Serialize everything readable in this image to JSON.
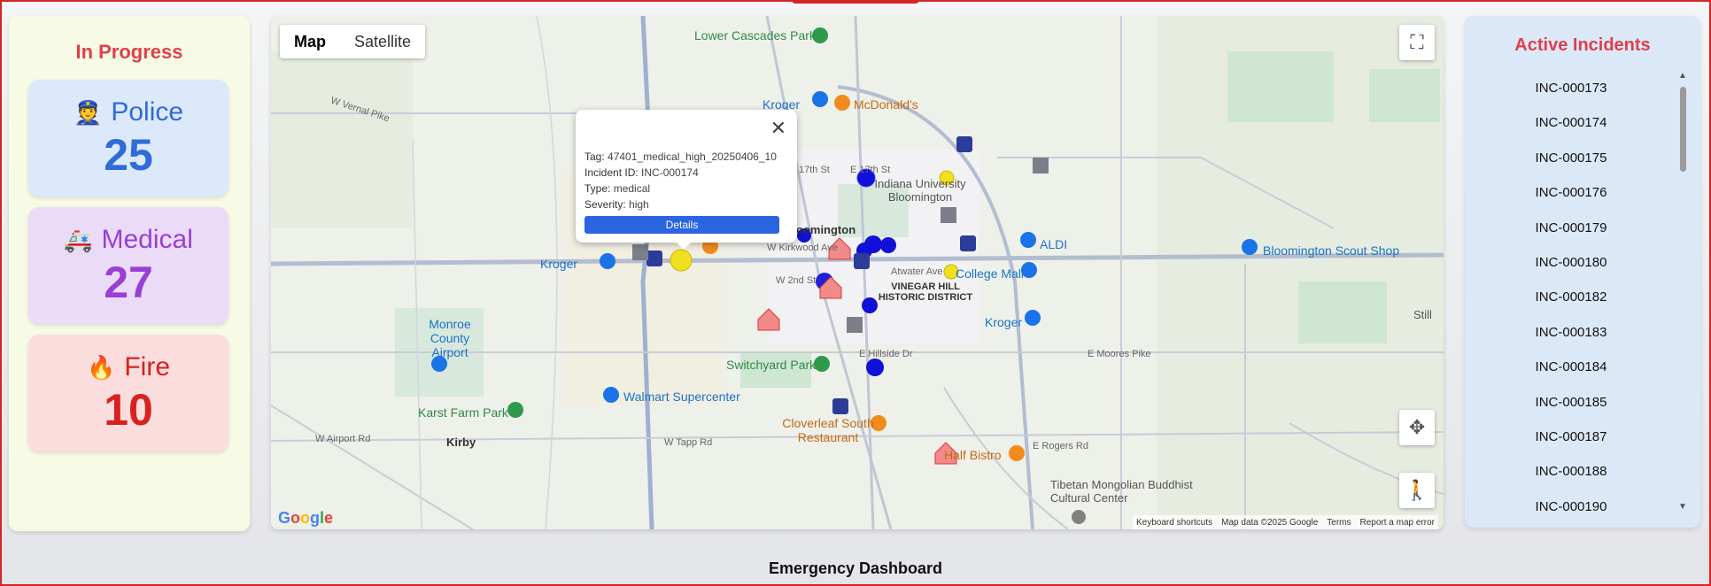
{
  "in_progress": {
    "title": "In Progress",
    "police": {
      "label": "Police",
      "count": "25",
      "icon": "police-officer-icon",
      "color": "#2f6cd8"
    },
    "medical": {
      "label": "Medical",
      "count": "27",
      "icon": "ambulance-icon",
      "color": "#9a3fd6"
    },
    "fire": {
      "label": "Fire",
      "count": "10",
      "icon": "fire-icon",
      "color": "#d82020"
    }
  },
  "map": {
    "toggle": {
      "map": "Map",
      "satellite": "Satellite"
    },
    "labels": {
      "lower_cascades": "Lower Cascades Park",
      "kroger1": "Kroger",
      "mcdonalds": "McDonald's",
      "w_vernal_pike": "W Vernal Pike",
      "indiana_univ": "Indiana University Bloomington",
      "aldi": "ALDI",
      "bloomington_scout": "Bloomington Scout Shop",
      "college_mall": "College Mall",
      "atwater": "Atwater Ave",
      "vinegar_hill": "VINEGAR HILL HISTORIC DISTRICT",
      "kroger2": "Kroger",
      "kroger3": "Kroger",
      "monroe_airport": "Monroe County Airport",
      "switchyard": "Switchyard Park",
      "walmart": "Walmart Supercenter",
      "karst": "Karst Farm Park",
      "kirby": "Kirby",
      "cloverleaf": "Cloverleaf South Restaurant",
      "half_bistro": "Half Bistro",
      "tibetan": "Tibetan Mongolian Buddhist Cultural Center",
      "hillside": "E Hillside Dr",
      "moores": "E Moores Pike",
      "rogers": "E Rogers Rd",
      "w_airport": "W Airport Rd",
      "w_tapp": "W Tapp Rd",
      "bloomington": "Bloomington",
      "e17th": "E 17th St",
      "w17th": "17th St",
      "kirkwood": "W Kirkwood Ave",
      "w2nd": "W 2nd St",
      "still": "Still"
    },
    "attribution": {
      "shortcuts": "Keyboard shortcuts",
      "data": "Map data ©2025 Google",
      "terms": "Terms",
      "report": "Report a map error"
    },
    "google": "Google"
  },
  "popup": {
    "tag_label": "Tag:",
    "tag": "47401_medical_high_20250406_10",
    "id_label": "Incident ID:",
    "id": "INC-000174",
    "type_label": "Type:",
    "type": "medical",
    "severity_label": "Severity:",
    "severity": "high",
    "details": "Details"
  },
  "active_incidents": {
    "title": "Active Incidents",
    "items": [
      "INC-000173",
      "INC-000174",
      "INC-000175",
      "INC-000176",
      "INC-000179",
      "INC-000180",
      "INC-000182",
      "INC-000183",
      "INC-000184",
      "INC-000185",
      "INC-000187",
      "INC-000188",
      "INC-000190"
    ]
  },
  "footer": {
    "title": "Emergency Dashboard"
  }
}
